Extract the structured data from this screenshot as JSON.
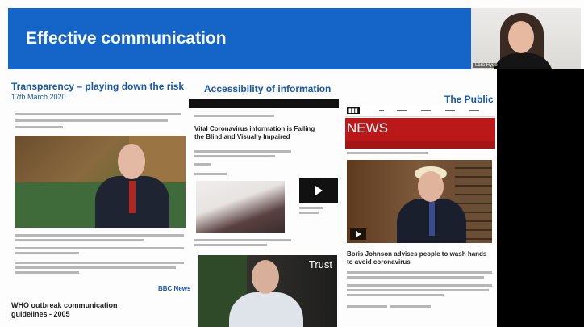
{
  "slide": {
    "title": "Effective communication"
  },
  "participant": {
    "name_tag": "Lara Hyde"
  },
  "sections": {
    "transparency": {
      "heading": "Transparency – playing down the risk",
      "date": "17th March 2020",
      "source": "BBC News",
      "who_heading_line1": "WHO outbreak communication",
      "who_heading_line2": "guidelines - 2005"
    },
    "accessibility": {
      "heading": "Accessibility of information",
      "article_title": "Vital Coronavirus information is Failing the Blind and Visually Impaired",
      "video_label": "Trust"
    },
    "public": {
      "heading": "The Public",
      "logo": "NEWS",
      "headline": "Boris Johnson advises people to wash hands to avoid coronavirus"
    }
  }
}
